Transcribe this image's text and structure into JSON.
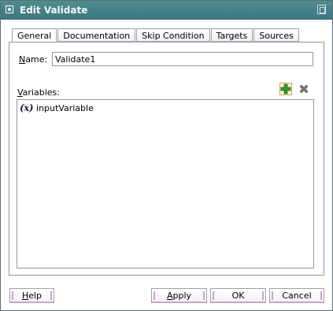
{
  "window": {
    "title": "Edit Validate"
  },
  "tabs": [
    {
      "label": "General",
      "active": true
    },
    {
      "label": "Documentation",
      "active": false
    },
    {
      "label": "Skip Condition",
      "active": false
    },
    {
      "label": "Targets",
      "active": false
    },
    {
      "label": "Sources",
      "active": false
    }
  ],
  "form": {
    "name_label_mnemonic": "N",
    "name_label_rest": "ame:",
    "name_value": "Validate1",
    "variables_label_mnemonic": "V",
    "variables_label_rest": "ariables:",
    "variables": [
      {
        "icon": "(x)",
        "name": "inputVariable"
      }
    ]
  },
  "buttons": {
    "help_mnemonic": "H",
    "help_rest": "elp",
    "apply_mnemonic": "A",
    "apply_rest": "pply",
    "ok": "OK",
    "cancel": "Cancel"
  },
  "icons": {
    "add": "add-plus-icon",
    "remove": "remove-x-icon",
    "variable": "variable-x-icon"
  },
  "colors": {
    "titlebar": "#3f7e84",
    "tab_accent": "#c9a3c6",
    "add_icon": "#2f9a2f",
    "remove_icon": "#7a7a7a"
  }
}
